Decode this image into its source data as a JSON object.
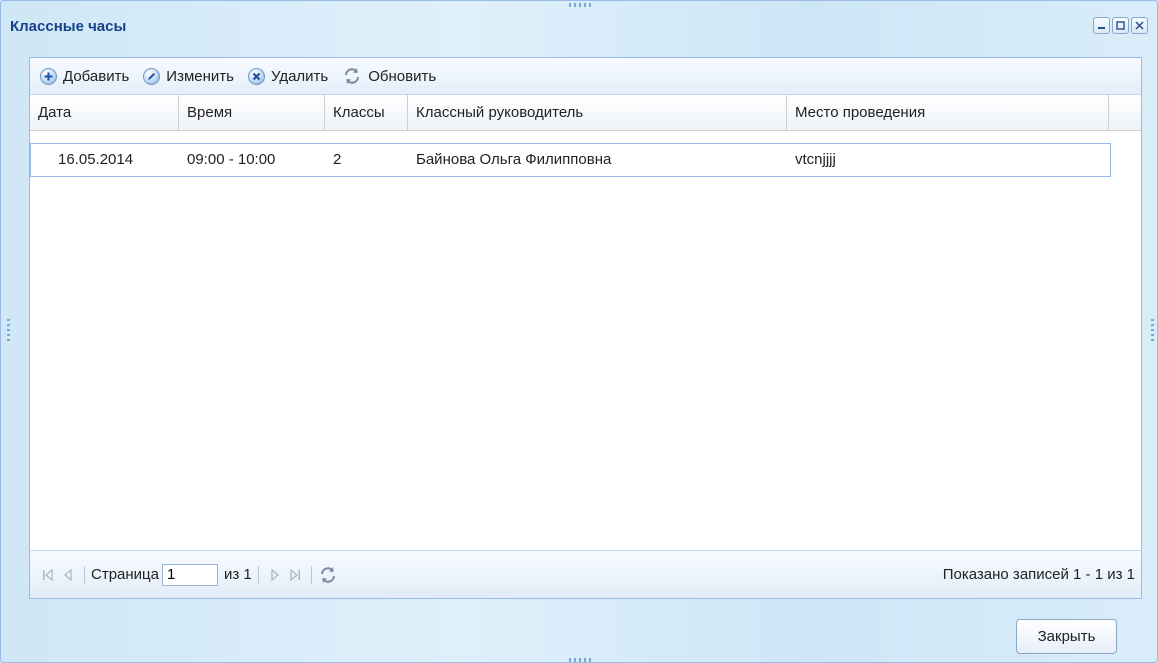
{
  "window": {
    "title": "Классные часы"
  },
  "toolbar": {
    "add_label": "Добавить",
    "edit_label": "Изменить",
    "delete_label": "Удалить",
    "refresh_label": "Обновить"
  },
  "grid": {
    "columns": [
      "Дата",
      "Время",
      "Классы",
      "Классный руководитель",
      "Место проведения"
    ],
    "rows": [
      {
        "date": "16.05.2014",
        "time": "09:00 - 10:00",
        "classes": "2",
        "teacher": "Байнова Ольга Филипповна",
        "place": "vtcnjjjj"
      }
    ]
  },
  "pager": {
    "page_label": "Страница",
    "page_value": "1",
    "of_label": "из 1",
    "info": "Показано записей 1 - 1 из 1"
  },
  "footer": {
    "close_label": "Закрыть"
  },
  "colors": {
    "accent": "#15428b",
    "border": "#99bbe8"
  }
}
